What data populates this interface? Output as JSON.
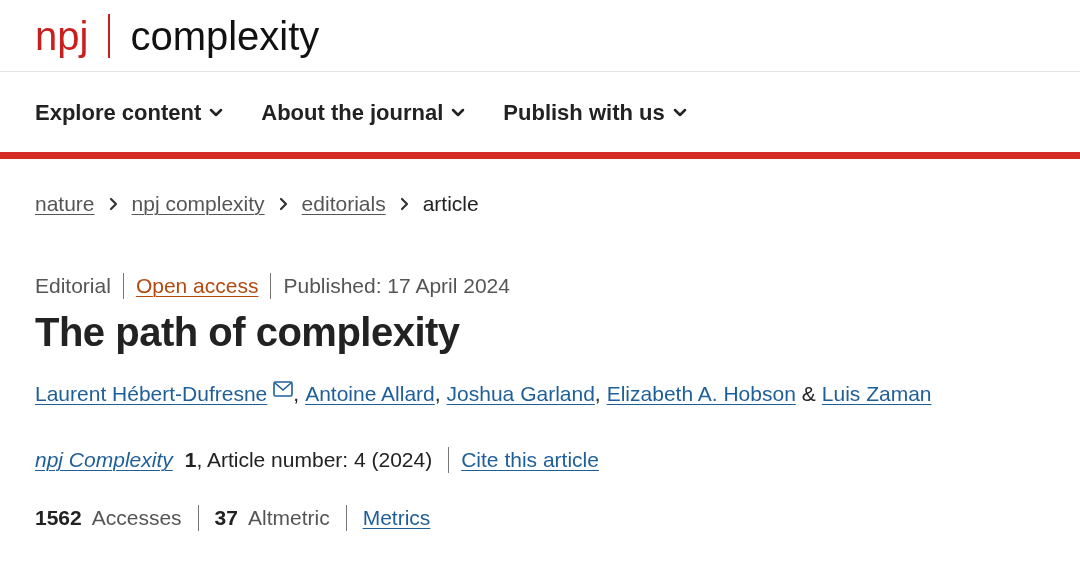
{
  "logo": {
    "brand": "npj",
    "journal": "complexity"
  },
  "nav": [
    {
      "label": "Explore content"
    },
    {
      "label": "About the journal"
    },
    {
      "label": "Publish with us"
    }
  ],
  "breadcrumbs": [
    {
      "label": "nature",
      "link": true
    },
    {
      "label": "npj complexity",
      "link": true
    },
    {
      "label": "editorials",
      "link": true
    },
    {
      "label": "article",
      "link": false
    }
  ],
  "article_meta": {
    "type": "Editorial",
    "access": "Open access",
    "published": "Published: 17 April 2024"
  },
  "title": "The path of complexity",
  "authors": [
    {
      "name": "Laurent Hébert-Dufresne",
      "email": true,
      "after": ","
    },
    {
      "name": "Antoine Allard",
      "email": false,
      "after": ","
    },
    {
      "name": "Joshua Garland",
      "email": false,
      "after": ","
    },
    {
      "name": "Elizabeth A. Hobson",
      "email": false,
      "after": "&"
    },
    {
      "name": "Luis Zaman",
      "email": false
    }
  ],
  "citation": {
    "journal": "npj Complexity",
    "volume": "1",
    "details": ", Article number: 4 (2024)",
    "cite_link": "Cite this article"
  },
  "metrics": [
    {
      "count": "1562",
      "name": "Accesses"
    },
    {
      "count": "37",
      "name": "Altmetric"
    }
  ],
  "metrics_link": "Metrics"
}
